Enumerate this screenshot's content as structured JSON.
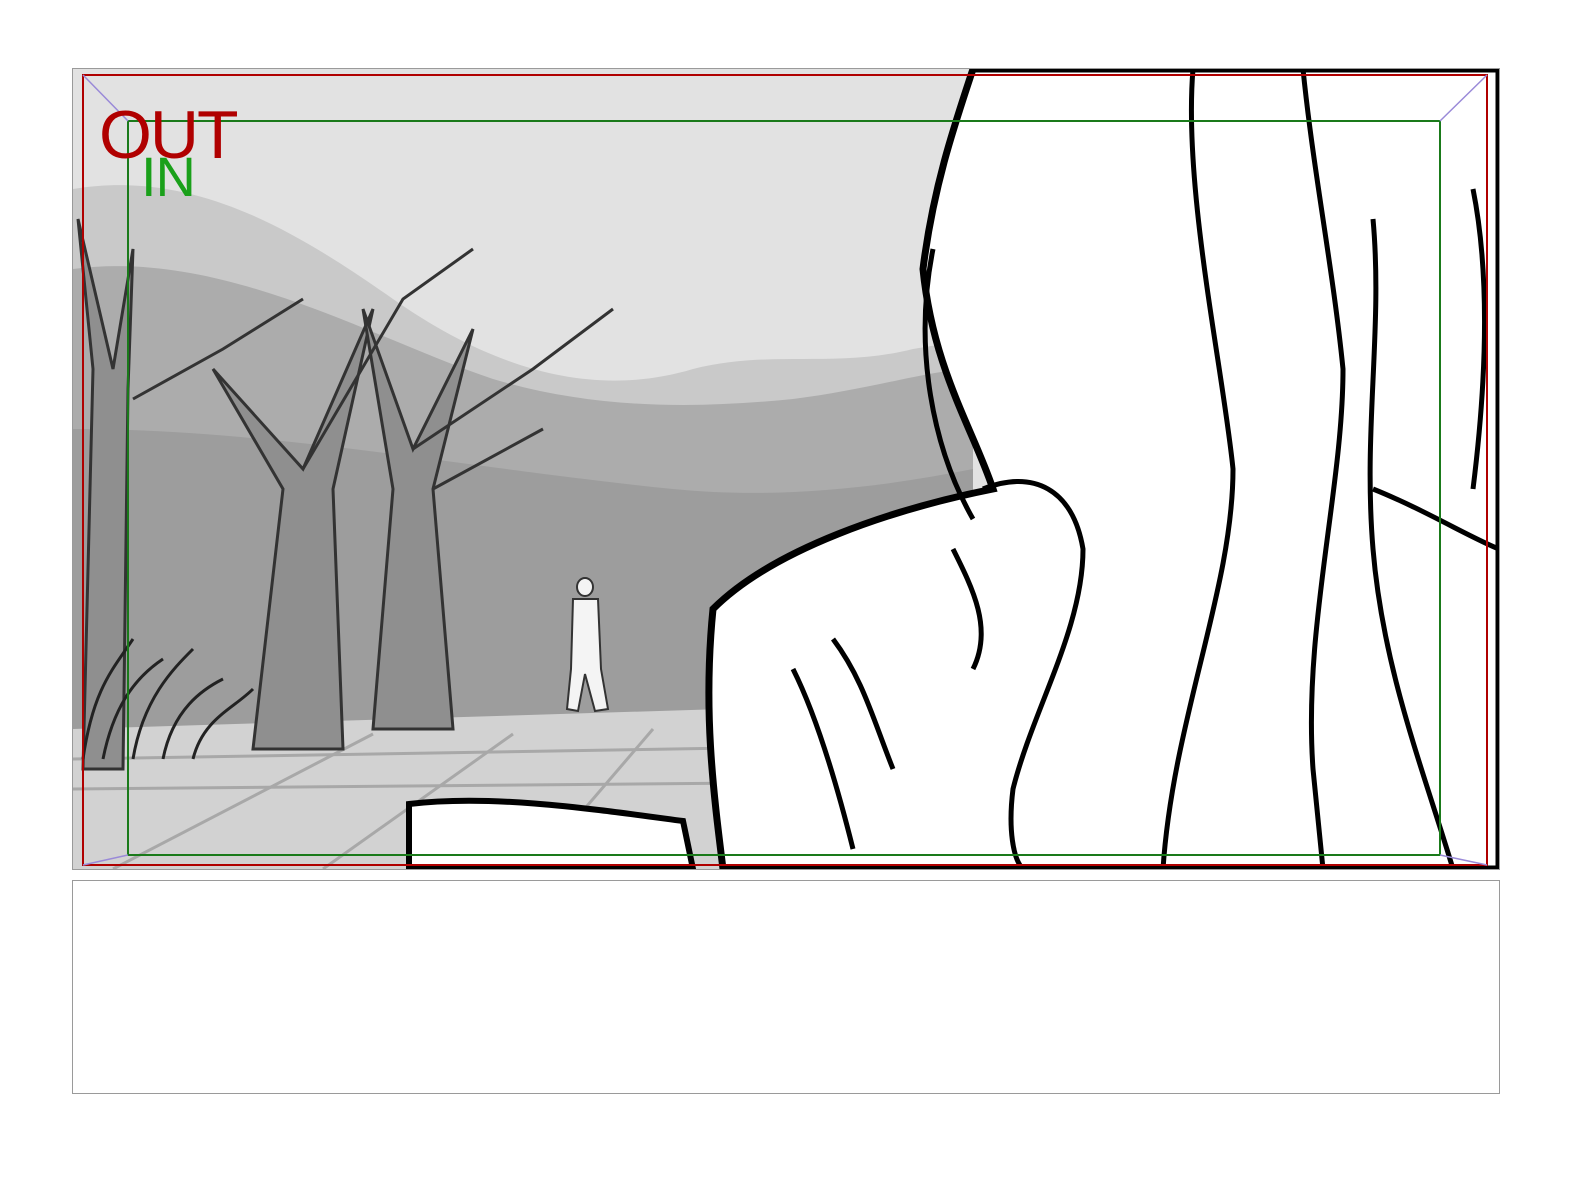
{
  "panel": {
    "out_label": "OUT",
    "in_label": "IN",
    "out_color": "#b00000",
    "in_color": "#1aa01a",
    "out_frame_color": "#b00000",
    "in_frame_color": "#1a7a1a",
    "corner_guide_color": "#9a8ad8"
  },
  "notes": {
    "text": ""
  }
}
